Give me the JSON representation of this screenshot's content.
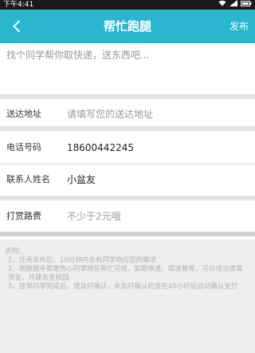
{
  "status_bar": {
    "time": "下午4:41"
  },
  "header": {
    "title": "帮忙跑腿",
    "publish": "发布"
  },
  "description": {
    "placeholder": "找个同学帮你取快递，送东西吧..."
  },
  "fields": {
    "address": {
      "label": "送达地址",
      "placeholder": "请填写您的送达地址"
    },
    "phone": {
      "label": "电话号码",
      "value": "18600442245"
    },
    "contact": {
      "label": "联系人姓名",
      "value": "小盆友"
    },
    "reward": {
      "label": "打赏路费",
      "placeholder": "不少于2元哦"
    }
  },
  "notes": {
    "title": "说明：",
    "lines": [
      "1，任务发布后，10分钟内会有同学响应您的需求",
      "2，跑腿服务都是热心同学相互帮忙完成，如取快递，取送餐等，可以适当提高赏金，共建友爱校园",
      "3，接单同学完成后，请及时确认，未及时确认的会在48小时后自动确认支付"
    ]
  }
}
